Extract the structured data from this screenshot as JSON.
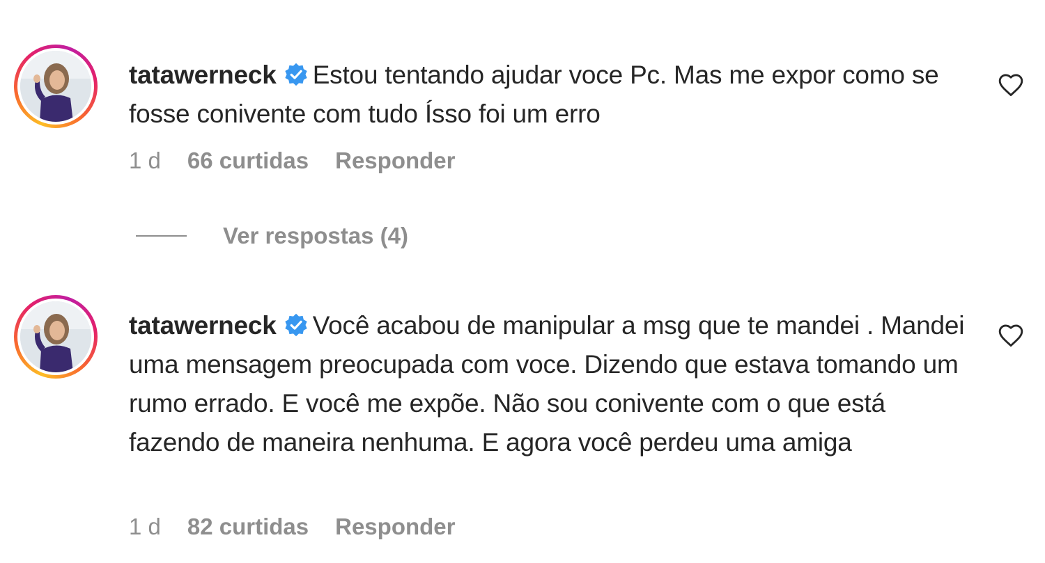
{
  "comments": [
    {
      "username": "tatawerneck",
      "verified": true,
      "text": "Estou tentando ajudar voce Pc. Mas me expor como se fosse conivente com tudo Ísso foi um erro",
      "time": "1 d",
      "likes": "66 curtidas",
      "reply_label": "Responder",
      "view_replies": "Ver respostas (4)"
    },
    {
      "username": "tatawerneck",
      "verified": true,
      "text": "Você acabou de manipular a msg que te mandei . Mandei uma mensagem preocupada com voce. Dizendo que estava tomando um rumo errado. E você me expõe. Não sou conivente com o que está fazendo de maneira nenhuma. E agora você perdeu uma amiga",
      "time": "1 d",
      "likes": "82 curtidas",
      "reply_label": "Responder"
    }
  ],
  "colors": {
    "text": "#262626",
    "secondary": "#8e8e8e",
    "verified": "#3897f0"
  },
  "icons": {
    "verified": "verified-badge-icon",
    "like": "heart-outline-icon"
  }
}
